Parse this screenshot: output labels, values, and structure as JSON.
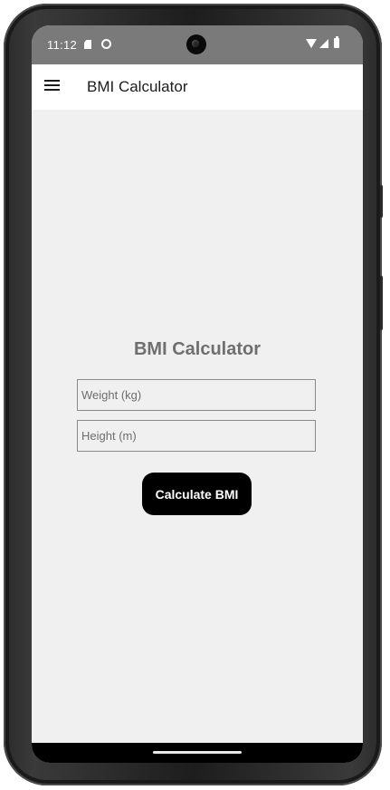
{
  "status_bar": {
    "time": "11:12",
    "icons": [
      "sd-card-icon",
      "circle-status-icon",
      "wifi-icon",
      "signal-icon",
      "battery-icon"
    ]
  },
  "app_bar": {
    "menu_icon": "hamburger-menu-icon",
    "title": "BMI Calculator"
  },
  "form": {
    "heading": "BMI Calculator",
    "weight": {
      "value": "",
      "placeholder": "Weight (kg)"
    },
    "height": {
      "value": "",
      "placeholder": "Height (m)"
    },
    "calculate_label": "Calculate BMI"
  },
  "colors": {
    "status_bar": "#7a7a7a",
    "app_bar": "#ffffff",
    "background": "#f0f0f0",
    "heading": "#6f6f6f",
    "button": "#000000",
    "button_text": "#ffffff"
  }
}
